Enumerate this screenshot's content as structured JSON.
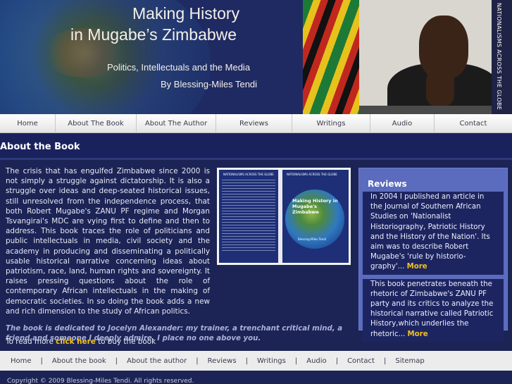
{
  "header": {
    "title_line1": "Making History",
    "title_line2": "in Mugabe’s Zimbabwe",
    "subtitle": "Politics, Intellectuals and the Media",
    "byline": "By Blessing-Miles Tendi",
    "series_tag": "NATIONALISMS ACROSS THE GLOBE"
  },
  "topnav": [
    {
      "label": "Home"
    },
    {
      "label": "About The Book"
    },
    {
      "label": "About The Author"
    },
    {
      "label": "Reviews"
    },
    {
      "label": "Writings"
    },
    {
      "label": "Audio"
    },
    {
      "label": "Contact"
    }
  ],
  "section": {
    "title": "About the Book"
  },
  "main": {
    "body": "The crisis that has engulfed Zimbabwe since 2000 is not simply a struggle against dictatorship. It is also a struggle over ideas and deep-seated historical issues, still unresolved from the independence process, that both Robert Mugabe's ZANU PF regime and Morgan Tsvangirai's MDC are vying first to define and then to address. This book traces the role of politicians and public intellectuals in media, civil society and the academy in producing and disseminating a politically usable historical narrative concerning ideas about patriotism, race, land, human rights and sovereignty. It raises pressing questions about the role of contemporary African intellectuals in the making of democratic societies. In so doing the book adds a new and rich dimension to the study of African politics.",
    "dedication": "The book is dedicated to Jocelyn Alexander: my trainer, a trenchant critical mind, a friend and someone I deeply admire. I place no one above you.",
    "buy_prefix": "To read more ",
    "buy_link": "click here",
    "buy_suffix": " to buy the book"
  },
  "cover": {
    "series": "NATIONALISMS ACROSS THE GLOBE",
    "title": "Making History in Mugabe's Zimbabwe",
    "author": "Blessing-Miles Tendi"
  },
  "reviews": {
    "heading": "Reviews",
    "items": [
      {
        "text": "In 2004 I published an article in the Journal of Southern African Studies on 'Nationalist Historiography, Patriotic History and the History of the Nation'. Its aim was to describe Robert Mugabe's 'rule by historio- graphy'...",
        "more": "More"
      },
      {
        "text": "This book penetrates beneath the rhetoric of Zimbabwe's ZANU PF party and its critics to analyze the historical narrative called Patriotic History,which underlies the rhetoric...",
        "more": "More"
      }
    ]
  },
  "footnav": [
    {
      "label": "Home"
    },
    {
      "label": "About the book"
    },
    {
      "label": "About the author"
    },
    {
      "label": "Reviews"
    },
    {
      "label": "Writings"
    },
    {
      "label": "Audio"
    },
    {
      "label": "Contact"
    },
    {
      "label": "Sitemap"
    }
  ],
  "footer": {
    "separator": "|",
    "copyright": "Copyright © 2009 Blessing-Miles Tendi. All rights reserved."
  },
  "colors": {
    "background": "#1c2456",
    "accent_link": "#f4c11a",
    "review_panel": "#5b6bbd"
  }
}
